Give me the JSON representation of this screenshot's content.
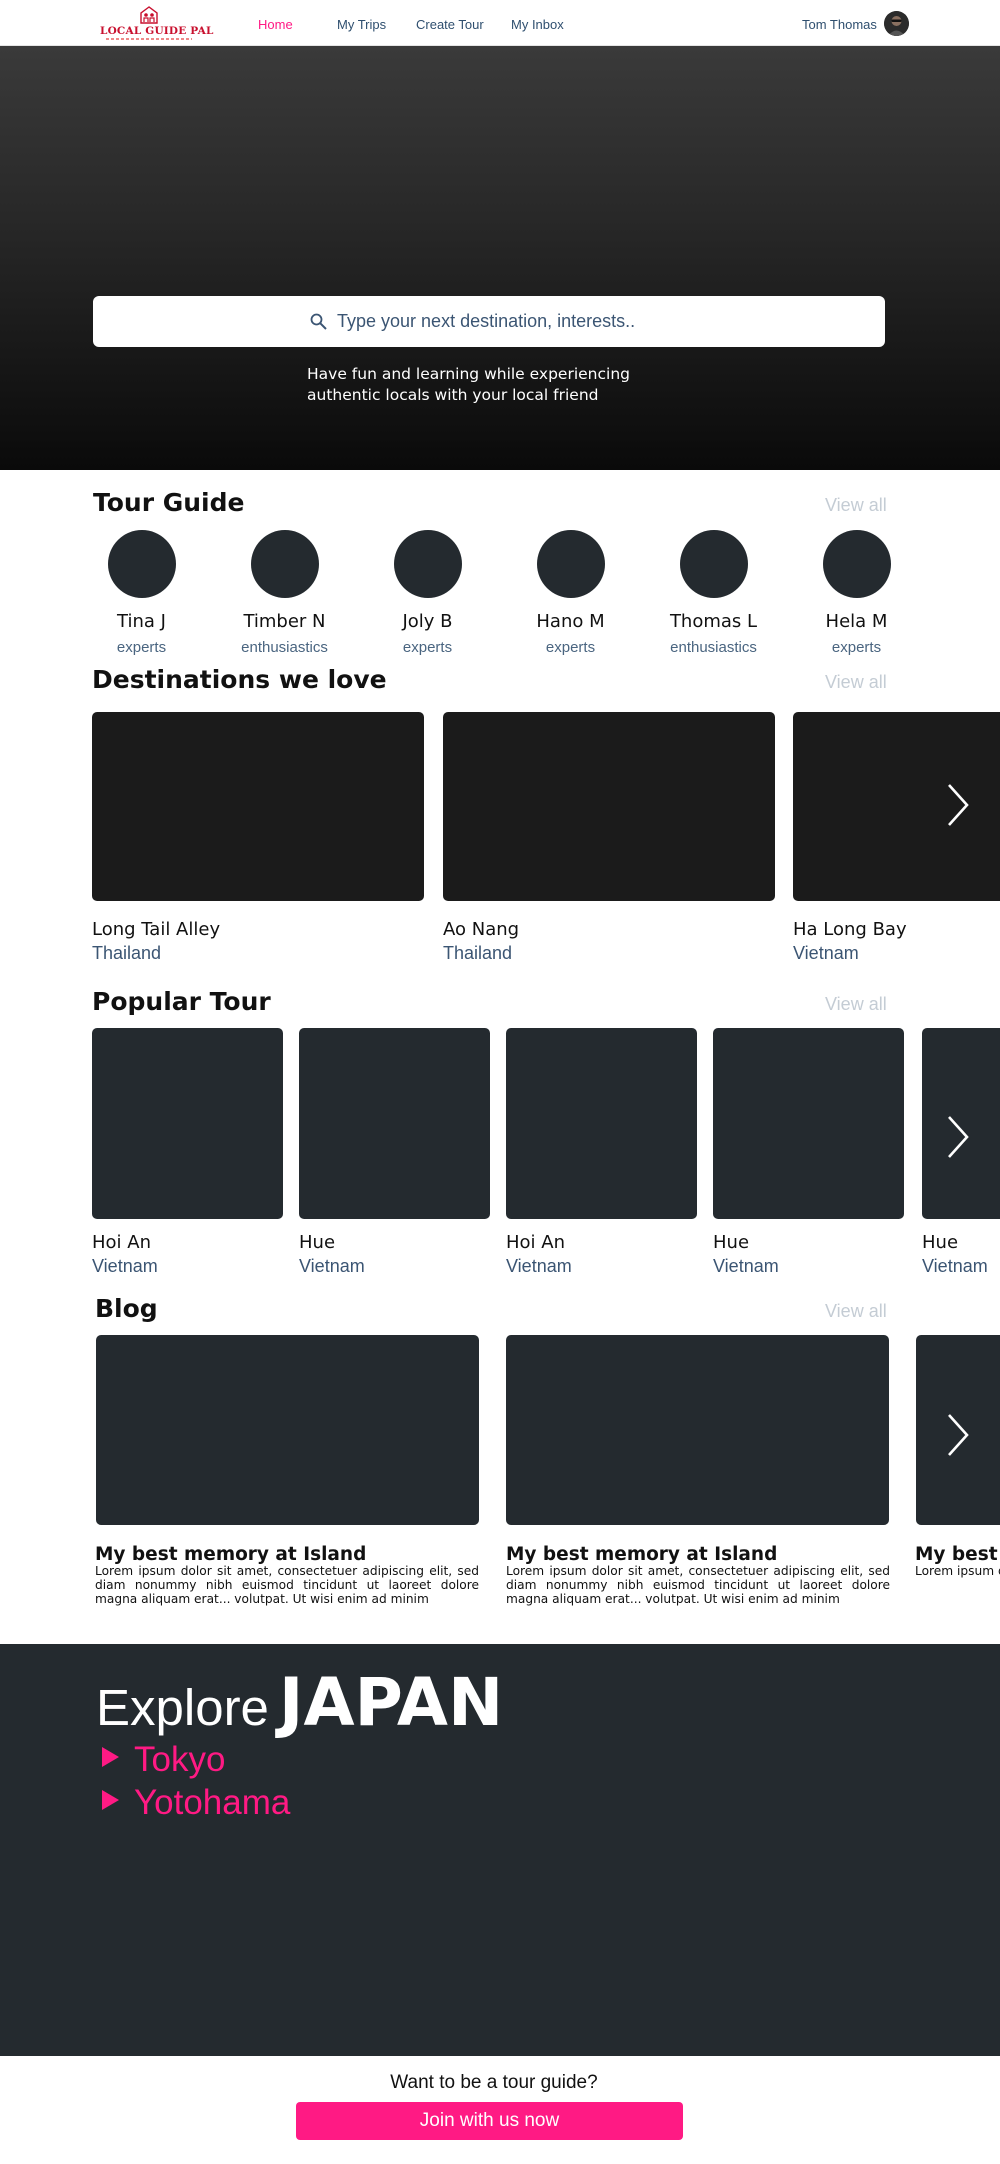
{
  "nav": {
    "logo_text": "LOCAL GUIDE PAL",
    "links": [
      "Home",
      "My Trips",
      "Create Tour",
      "My Inbox"
    ],
    "user_name": "Tom Thomas"
  },
  "hero": {
    "search_placeholder": "Type your next destination, interests..",
    "tagline_line1": "Have fun and learning while experiencing",
    "tagline_line2": "authentic locals with your local friend"
  },
  "tour_guide": {
    "title": "Tour Guide",
    "view_all": "View all",
    "guides": [
      {
        "name": "Tina J",
        "role": "experts"
      },
      {
        "name": "Timber N",
        "role": "enthusiastics"
      },
      {
        "name": "Joly B",
        "role": "experts"
      },
      {
        "name": "Hano M",
        "role": "experts"
      },
      {
        "name": "Thomas L",
        "role": "enthusiastics"
      },
      {
        "name": "Hela M",
        "role": "experts"
      }
    ]
  },
  "destinations": {
    "title": "Destinations we love",
    "view_all": "View all",
    "items": [
      {
        "name": "Long Tail Alley",
        "country": "Thailand"
      },
      {
        "name": "Ao Nang",
        "country": "Thailand"
      },
      {
        "name": "Ha Long Bay",
        "country": "Vietnam"
      }
    ]
  },
  "popular_tour": {
    "title": "Popular Tour",
    "view_all": "View all",
    "items": [
      {
        "name": "Hoi An",
        "country": "Vietnam"
      },
      {
        "name": "Hue",
        "country": "Vietnam"
      },
      {
        "name": "Hoi An",
        "country": "Vietnam"
      },
      {
        "name": "Hue",
        "country": "Vietnam"
      },
      {
        "name": "Hue",
        "country": "Vietnam"
      }
    ]
  },
  "blog": {
    "title": "Blog",
    "view_all": "View all",
    "posts": [
      {
        "title": "My best memory at Island",
        "excerpt": "Lorem ipsum dolor sit amet, consectetuer adipiscing elit, sed diam nonummy nibh euismod tincidunt ut laoreet dolore magna aliquam erat... volutpat. Ut wisi enim ad minim"
      },
      {
        "title": "My best memory at Island",
        "excerpt": "Lorem ipsum dolor sit amet, consectetuer adipiscing elit, sed diam nonummy nibh euismod tincidunt ut laoreet dolore magna aliquam erat... volutpat. Ut wisi enim ad minim"
      },
      {
        "title": "My best memory at Island",
        "excerpt": "Lorem ipsum dolor sit amet, consectetuer adipiscing elit, sed diam nonummy nibh euismod tincidunt ut laoreet dolore magna aliquam erat... volutpat. Ut wisi enim ad minim"
      }
    ]
  },
  "explore": {
    "word": "Explore",
    "country": "JAPAN",
    "cities": [
      "Tokyo",
      "Yotohama"
    ]
  },
  "footer": {
    "question": "Want to be a tour guide?",
    "join_label": "Join with us now"
  },
  "colors": {
    "accent": "#ff1a84",
    "dark_panel": "#242a2f",
    "muted_link": "#3b5573",
    "logo_red": "#c8102e"
  },
  "icons": {
    "search": "search-icon",
    "next": "chevron-right-icon",
    "logo": "house-people-icon",
    "play": "triangle-right-icon"
  }
}
